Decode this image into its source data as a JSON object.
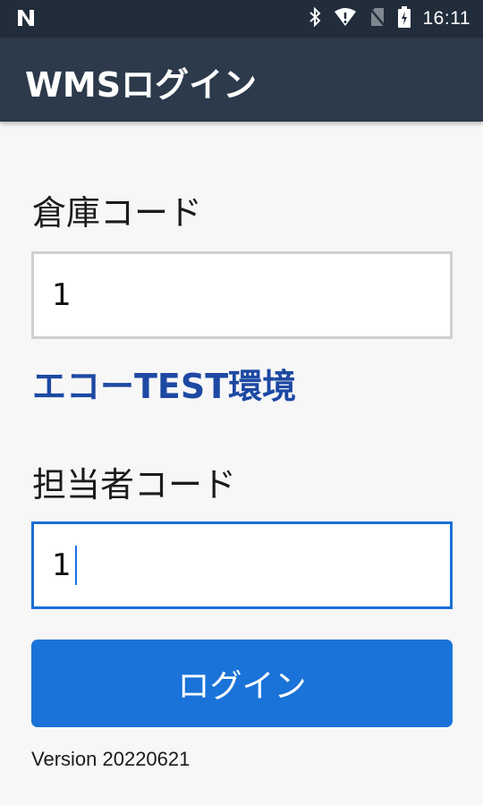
{
  "status_bar": {
    "time": "16:11",
    "icons": [
      "n-logo-icon",
      "bluetooth-icon",
      "wifi-icon",
      "no-sim-icon",
      "battery-charging-icon"
    ]
  },
  "app_bar": {
    "title": "WMSログイン"
  },
  "form": {
    "warehouse_label": "倉庫コード",
    "warehouse_value": "1",
    "environment_label": "エコーTEST環境",
    "staff_label": "担当者コード",
    "staff_value": "1",
    "login_button": "ログイン"
  },
  "footer": {
    "version": "Version 20220621"
  },
  "colors": {
    "status_bar": "#222d3b",
    "app_bar": "#2c3a4b",
    "accent": "#1a73d9",
    "environment_text": "#1d49a3",
    "focused_border": "#1a6fd6"
  }
}
